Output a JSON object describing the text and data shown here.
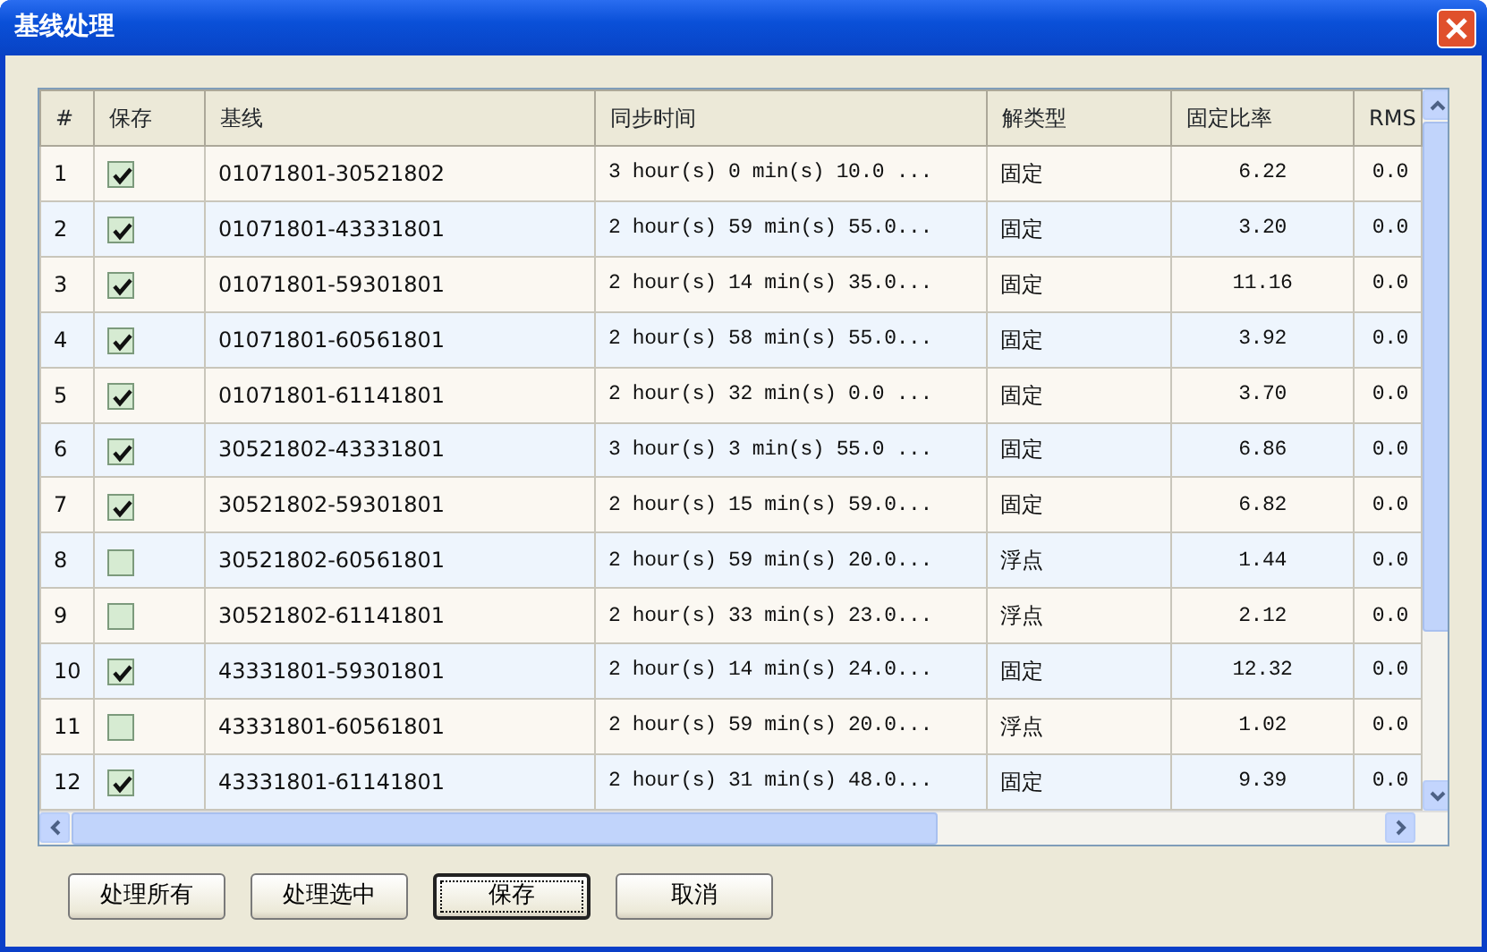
{
  "window": {
    "title": "基线处理"
  },
  "table": {
    "columns": [
      "#",
      "保存",
      "基线",
      "同步时间",
      "解类型",
      "固定比率",
      "RMS"
    ],
    "rows": [
      {
        "index": "1",
        "saved": true,
        "baseline": "01071801-30521802",
        "time": "3 hour(s) 0 min(s) 10.0 ...",
        "type": "固定",
        "ratio": "6.22",
        "rms": "0.0"
      },
      {
        "index": "2",
        "saved": true,
        "baseline": "01071801-43331801",
        "time": "2 hour(s) 59 min(s) 55.0...",
        "type": "固定",
        "ratio": "3.20",
        "rms": "0.0"
      },
      {
        "index": "3",
        "saved": true,
        "baseline": "01071801-59301801",
        "time": "2 hour(s) 14 min(s) 35.0...",
        "type": "固定",
        "ratio": "11.16",
        "rms": "0.0"
      },
      {
        "index": "4",
        "saved": true,
        "baseline": "01071801-60561801",
        "time": "2 hour(s) 58 min(s) 55.0...",
        "type": "固定",
        "ratio": "3.92",
        "rms": "0.0"
      },
      {
        "index": "5",
        "saved": true,
        "baseline": "01071801-61141801",
        "time": "2 hour(s) 32 min(s) 0.0 ...",
        "type": "固定",
        "ratio": "3.70",
        "rms": "0.0"
      },
      {
        "index": "6",
        "saved": true,
        "baseline": "30521802-43331801",
        "time": "3 hour(s) 3 min(s) 55.0 ...",
        "type": "固定",
        "ratio": "6.86",
        "rms": "0.0"
      },
      {
        "index": "7",
        "saved": true,
        "baseline": "30521802-59301801",
        "time": "2 hour(s) 15 min(s) 59.0...",
        "type": "固定",
        "ratio": "6.82",
        "rms": "0.0"
      },
      {
        "index": "8",
        "saved": false,
        "baseline": "30521802-60561801",
        "time": "2 hour(s) 59 min(s) 20.0...",
        "type": "浮点",
        "ratio": "1.44",
        "rms": "0.0"
      },
      {
        "index": "9",
        "saved": false,
        "baseline": "30521802-61141801",
        "time": "2 hour(s) 33 min(s) 23.0...",
        "type": "浮点",
        "ratio": "2.12",
        "rms": "0.0"
      },
      {
        "index": "10",
        "saved": true,
        "baseline": "43331801-59301801",
        "time": "2 hour(s) 14 min(s) 24.0...",
        "type": "固定",
        "ratio": "12.32",
        "rms": "0.0"
      },
      {
        "index": "11",
        "saved": false,
        "baseline": "43331801-60561801",
        "time": "2 hour(s) 59 min(s) 20.0...",
        "type": "浮点",
        "ratio": "1.02",
        "rms": "0.0"
      },
      {
        "index": "12",
        "saved": true,
        "baseline": "43331801-61141801",
        "time": "2 hour(s) 31 min(s) 48.0...",
        "type": "固定",
        "ratio": "9.39",
        "rms": "0.0"
      }
    ]
  },
  "buttons": [
    {
      "label": "处理所有",
      "focused": false
    },
    {
      "label": "处理选中",
      "focused": false
    },
    {
      "label": "保存",
      "focused": true
    },
    {
      "label": "取消",
      "focused": false
    }
  ]
}
